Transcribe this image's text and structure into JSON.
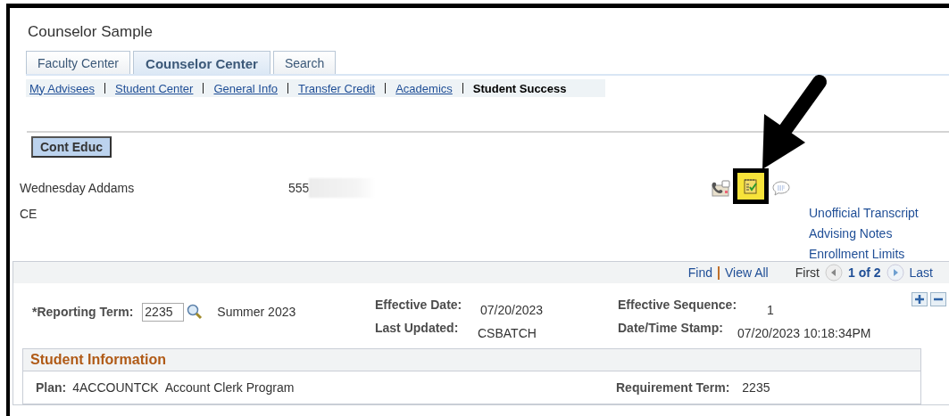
{
  "page_title": "Counselor Sample",
  "tabs": [
    {
      "label": "Faculty Center",
      "selected": false
    },
    {
      "label": "Counselor Center",
      "selected": true
    },
    {
      "label": "Search",
      "selected": false
    }
  ],
  "subnav": [
    {
      "label": "My Advisees",
      "selected": false
    },
    {
      "label": "Student Center",
      "selected": false
    },
    {
      "label": "General Info",
      "selected": false
    },
    {
      "label": "Transfer Credit",
      "selected": false
    },
    {
      "label": "Academics",
      "selected": false
    },
    {
      "label": "Student Success",
      "selected": true
    }
  ],
  "career_button": "Cont Educ",
  "toolbar_icons": [
    {
      "kind": "contact",
      "highlighted": false
    },
    {
      "kind": "notes",
      "highlighted": true
    },
    {
      "kind": "comment",
      "highlighted": false
    }
  ],
  "student": {
    "name": "Wednesday Addams",
    "id": "555",
    "id_redacted": true,
    "career": "CE"
  },
  "side_links": [
    "Unofficial Transcript",
    "Advising Notes",
    "Enrollment Limits"
  ],
  "grid": {
    "find": "Find",
    "view_all": "View All",
    "first": "First",
    "position": "1 of 2",
    "last": "Last",
    "reporting_term_label": "*Reporting Term:",
    "reporting_term": "2235",
    "term_description": "Summer 2023",
    "effective_date_label": "Effective Date:",
    "effective_date": "07/20/2023",
    "last_updated_label": "Last Updated:",
    "last_updated": "CSBATCH",
    "effective_sequence_label": "Effective Sequence:",
    "effective_sequence": "1",
    "stamp_label": "Date/Time Stamp:",
    "stamp": "07/20/2023 10:18:34PM"
  },
  "student_information": {
    "title": "Student Information",
    "plan_label": "Plan:",
    "plan_code": "4ACCOUNTCK",
    "plan_description": "Account Clerk Program",
    "requirement_term_label": "Requirement Term:",
    "requirement_term": "2235"
  }
}
